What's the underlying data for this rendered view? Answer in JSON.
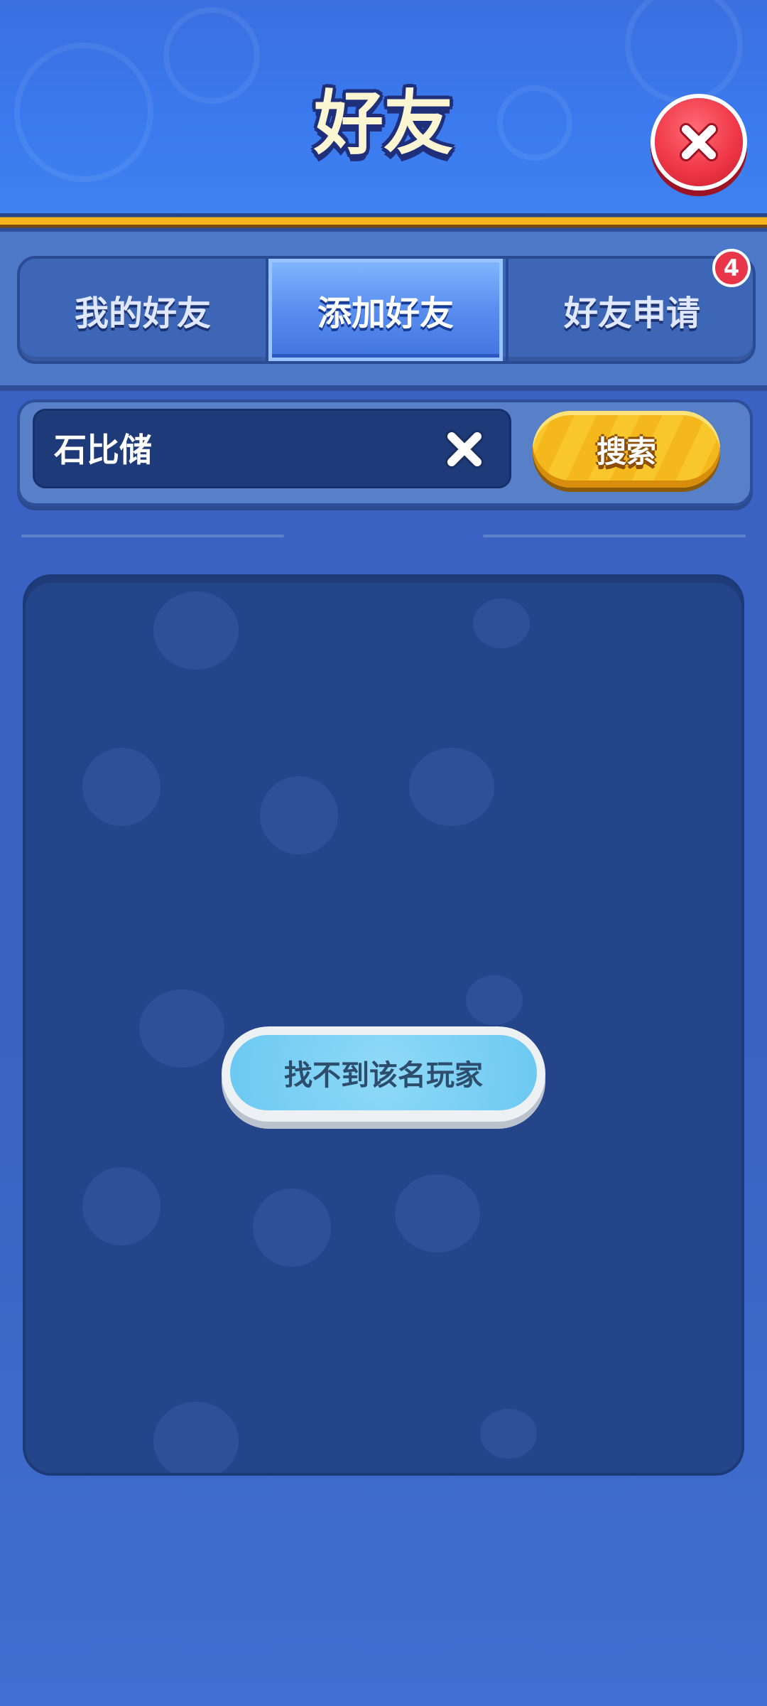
{
  "header": {
    "title": "好友"
  },
  "tabs": [
    {
      "label": "我的好友",
      "selected": false
    },
    {
      "label": "添加好友",
      "selected": true
    },
    {
      "label": "好友申请",
      "selected": false,
      "badge": "4"
    }
  ],
  "search": {
    "value": "石比储",
    "button_label": "搜索"
  },
  "result": {
    "message": "找不到该名玩家"
  },
  "colors": {
    "accent": "#3a7aee",
    "close": "#f03848",
    "search_button": "#f7c72c",
    "badge": "#e83549"
  },
  "icons": {
    "close": "close-icon",
    "clear": "clear-x-icon"
  }
}
